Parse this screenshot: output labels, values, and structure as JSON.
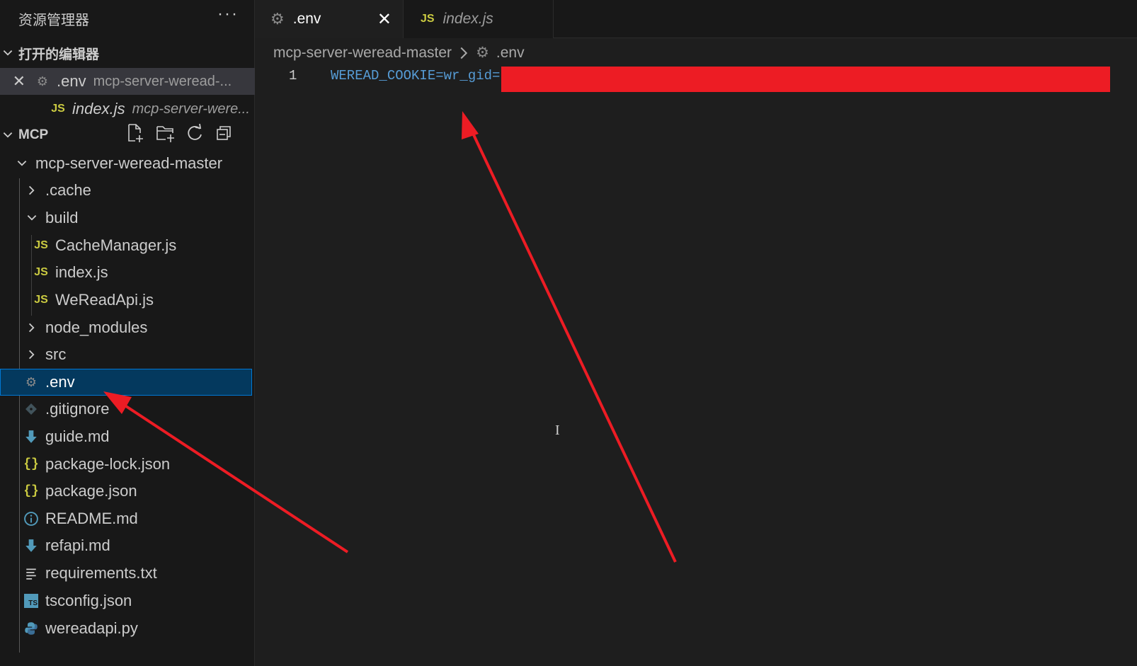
{
  "sidebar": {
    "title": "资源管理器",
    "more_label": "···",
    "open_editors": {
      "header": "打开的编辑器",
      "items": [
        {
          "name": ".env",
          "desc": "mcp-server-weread-...",
          "close": "✕"
        },
        {
          "name": "index.js",
          "desc": "mcp-server-were...",
          "icon_text": "JS"
        }
      ]
    },
    "workspace": {
      "header": "MCP",
      "root_folder": "mcp-server-weread-master",
      "tree": [
        {
          "label": ".cache",
          "type": "folder-collapsed"
        },
        {
          "label": "build",
          "type": "folder-expanded"
        },
        {
          "label": "CacheManager.js",
          "type": "js"
        },
        {
          "label": "index.js",
          "type": "js"
        },
        {
          "label": "WeReadApi.js",
          "type": "js"
        },
        {
          "label": "node_modules",
          "type": "folder-collapsed"
        },
        {
          "label": "src",
          "type": "folder-collapsed"
        },
        {
          "label": ".env",
          "type": "gear"
        },
        {
          "label": ".gitignore",
          "type": "git"
        },
        {
          "label": "guide.md",
          "type": "md"
        },
        {
          "label": "package-lock.json",
          "type": "json"
        },
        {
          "label": "package.json",
          "type": "json"
        },
        {
          "label": "README.md",
          "type": "info"
        },
        {
          "label": "refapi.md",
          "type": "md"
        },
        {
          "label": "requirements.txt",
          "type": "txt"
        },
        {
          "label": "tsconfig.json",
          "type": "ts"
        },
        {
          "label": "wereadapi.py",
          "type": "py"
        }
      ]
    },
    "js_icon_text": "JS",
    "json_icon_text": "{}",
    "ts_icon_text": "TS"
  },
  "tabs": [
    {
      "label": ".env",
      "active": true,
      "close": "✕"
    },
    {
      "label": "index.js",
      "active": false,
      "icon_text": "JS"
    }
  ],
  "breadcrumb": {
    "folder": "mcp-server-weread-master",
    "file": ".env"
  },
  "editor": {
    "line_number": "1",
    "code": "WEREAD_COOKIE=wr_gid="
  },
  "colors": {
    "annotation_red": "#ed1c24",
    "selection_bg": "#04395e",
    "selection_border": "#0078d4",
    "js_yellow": "#cbcb41",
    "md_blue": "#519aba"
  }
}
